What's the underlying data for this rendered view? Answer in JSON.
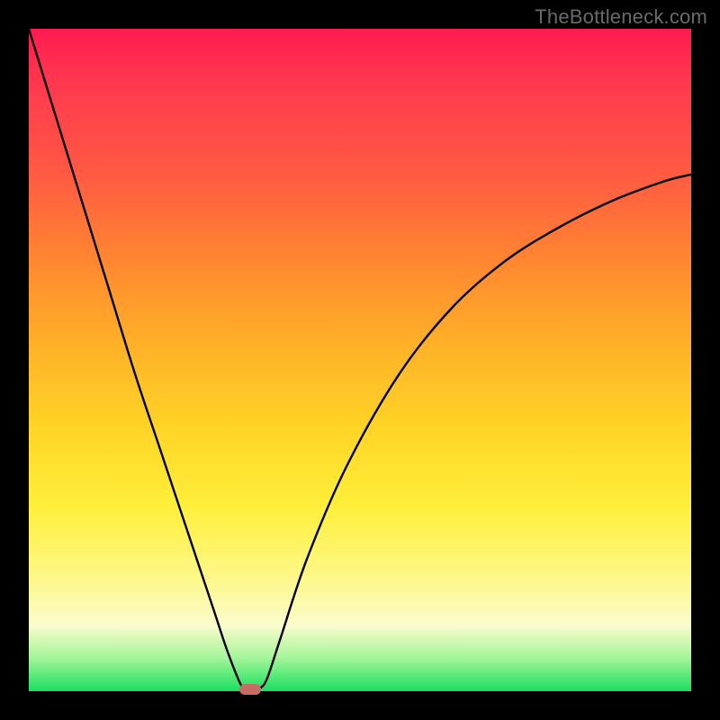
{
  "watermark_text": "TheBottleneck.com",
  "chart_data": {
    "type": "line",
    "title": "",
    "xlabel": "",
    "ylabel": "",
    "xlim": [
      0,
      100
    ],
    "ylim": [
      0,
      100
    ],
    "grid": false,
    "legend": false,
    "series": [
      {
        "name": "bottleneck-curve",
        "x": [
          0,
          4,
          8,
          12,
          16,
          20,
          24,
          28,
          30,
          32,
          33,
          34,
          35,
          36,
          38,
          42,
          48,
          56,
          64,
          72,
          80,
          88,
          96,
          100
        ],
        "y": [
          100,
          87,
          74,
          61,
          48,
          36,
          24,
          12,
          6,
          1,
          0,
          0,
          0.5,
          2,
          8,
          20,
          34,
          48,
          58,
          65,
          70,
          74,
          77,
          78
        ]
      }
    ],
    "annotations": [
      {
        "name": "min-marker",
        "x": 33.4,
        "y": 0,
        "shape": "pill",
        "color": "#c96b65"
      }
    ],
    "background": {
      "type": "vertical-gradient",
      "stops": [
        {
          "pos": 0,
          "color": "#ff1a50"
        },
        {
          "pos": 22,
          "color": "#ff5a42"
        },
        {
          "pos": 48,
          "color": "#ffb228"
        },
        {
          "pos": 72,
          "color": "#ffef3a"
        },
        {
          "pos": 90,
          "color": "#fbfccc"
        },
        {
          "pos": 100,
          "color": "#18e05e"
        }
      ]
    }
  }
}
